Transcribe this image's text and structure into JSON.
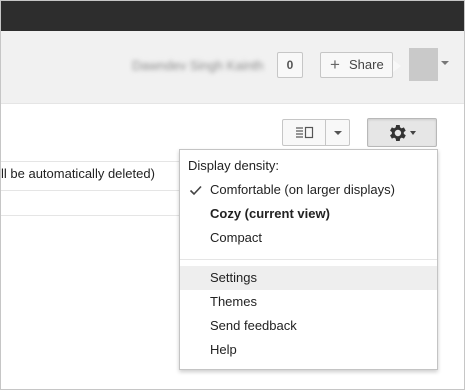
{
  "account": {
    "user_name": "Dawndev Singh Kainth",
    "count": "0",
    "share_label": "Share"
  },
  "toolbar": {
    "view_toggle_icon": "split-pane-icon",
    "gear_icon": "gear-icon"
  },
  "content": {
    "notice_text": "ll be automatically deleted)"
  },
  "menu": {
    "heading": "Display density:",
    "density_options": [
      {
        "label": "Comfortable (on larger displays)",
        "checked": true,
        "bold": false
      },
      {
        "label": "Cozy (current view)",
        "checked": false,
        "bold": true
      },
      {
        "label": "Compact",
        "checked": false,
        "bold": false
      }
    ],
    "actions": [
      {
        "label": "Settings",
        "highlighted": true
      },
      {
        "label": "Themes",
        "highlighted": false
      },
      {
        "label": "Send feedback",
        "highlighted": false
      },
      {
        "label": "Help",
        "highlighted": false
      }
    ]
  },
  "colors": {
    "topbar": "#2d2d2d",
    "account_bar": "#f1f1f1",
    "menu_hover": "#eeeeee"
  }
}
